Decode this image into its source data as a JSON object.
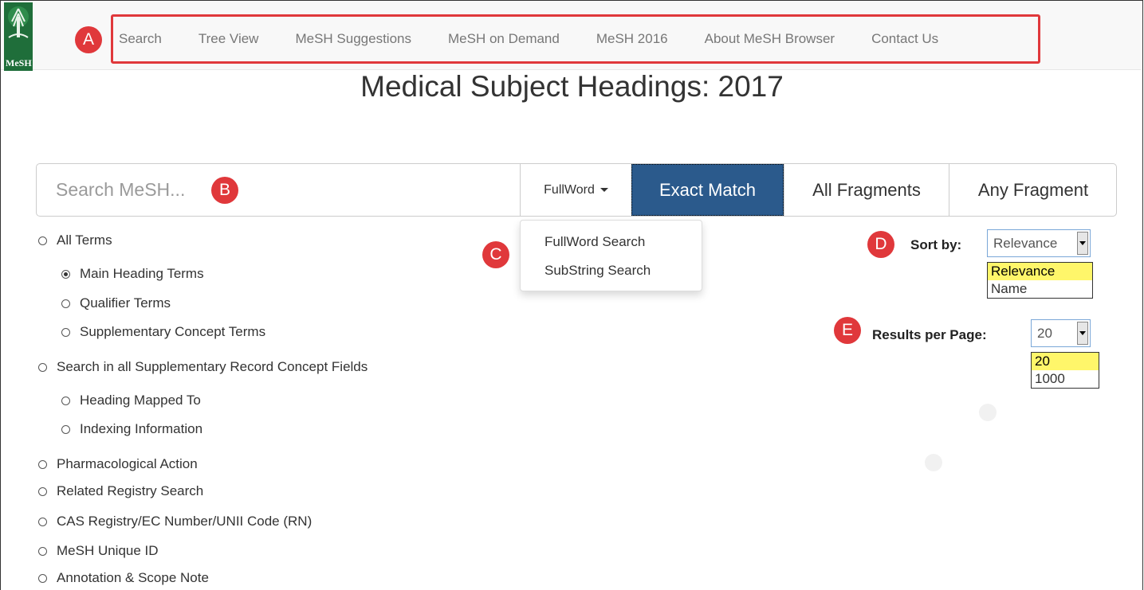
{
  "logo": {
    "text": "MeSH"
  },
  "nav": {
    "items": [
      "Search",
      "Tree View",
      "MeSH Suggestions",
      "MeSH on Demand",
      "MeSH 2016",
      "About MeSH Browser",
      "Contact Us"
    ]
  },
  "markers": {
    "a": "A",
    "b": "B",
    "c": "C",
    "d": "D",
    "e": "E"
  },
  "page_title": "Medical Subject Headings: 2017",
  "search": {
    "placeholder": "Search MeSH...",
    "value": "",
    "mode_label": "FullWord",
    "buttons": {
      "exact": "Exact Match",
      "all_fragments": "All Fragments",
      "any_fragment": "Any Fragment"
    },
    "selected_button": "Exact Match"
  },
  "mode_dropdown": {
    "items": [
      "FullWord Search",
      "SubString Search"
    ]
  },
  "scope_options": [
    {
      "label": "All Terms",
      "checked": false,
      "level": 0
    },
    {
      "label": "Main Heading Terms",
      "checked": true,
      "level": 1
    },
    {
      "label": "Qualifier Terms",
      "checked": false,
      "level": 1
    },
    {
      "label": "Supplementary Concept Terms",
      "checked": false,
      "level": 1
    },
    {
      "label": "Search in all Supplementary Record Concept Fields",
      "checked": false,
      "level": 0
    },
    {
      "label": "Heading Mapped To",
      "checked": false,
      "level": 1
    },
    {
      "label": "Indexing Information",
      "checked": false,
      "level": 1
    },
    {
      "label": "Pharmacological Action",
      "checked": false,
      "level": 0
    },
    {
      "label": "Related Registry Search",
      "checked": false,
      "level": 0
    },
    {
      "label": "CAS Registry/EC Number/UNII Code (RN)",
      "checked": false,
      "level": 0
    },
    {
      "label": "MeSH Unique ID",
      "checked": false,
      "level": 0
    },
    {
      "label": "Annotation & Scope Note",
      "checked": false,
      "level": 0
    }
  ],
  "sort": {
    "label": "Sort by:",
    "value": "Relevance",
    "options": [
      "Relevance",
      "Name"
    ],
    "selected": "Relevance"
  },
  "results_per_page": {
    "label": "Results per Page:",
    "value": "20",
    "options": [
      "20",
      "1000"
    ],
    "selected": "20"
  },
  "colors": {
    "accent_marker": "#e0383b",
    "primary_button": "#2b5a8c",
    "logo_green": "#1f6e3a",
    "option_highlight": "#fff66a"
  }
}
